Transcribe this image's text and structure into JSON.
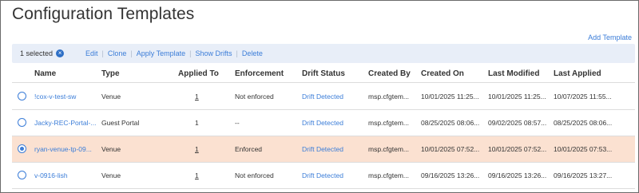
{
  "page": {
    "title": "Configuration Templates",
    "add_template": "Add Template"
  },
  "toolbar": {
    "selected_count": "1 selected",
    "clear_icon": "×",
    "actions": [
      "Edit",
      "Clone",
      "Apply Template",
      "Show Drifts",
      "Delete"
    ]
  },
  "table": {
    "headers": [
      "Name",
      "Type",
      "Applied To",
      "Enforcement",
      "Drift Status",
      "Created By",
      "Created On",
      "Last Modified",
      "Last Applied"
    ],
    "rows": [
      {
        "name": "!cox-v-test-sw",
        "type": "Venue",
        "applied_to": "1",
        "enforcement": "Not enforced",
        "drift_status": "Drift Detected",
        "created_by": "msp.cfgtem...",
        "created_on": "10/01/2025 11:25...",
        "last_modified": "10/01/2025 11:25...",
        "last_applied": "10/07/2025 11:55...",
        "selected": false
      },
      {
        "name": "Jacky-REC-Portal-...",
        "type": "Guest Portal",
        "applied_to": "1",
        "enforcement": "--",
        "drift_status": "Drift Detected",
        "created_by": "msp.cfgtem...",
        "created_on": "08/25/2025 08:06...",
        "last_modified": "09/02/2025 08:57...",
        "last_applied": "08/25/2025 08:06...",
        "selected": false
      },
      {
        "name": "ryan-venue-tp-09...",
        "type": "Venue",
        "applied_to": "1",
        "enforcement": "Enforced",
        "drift_status": "Drift Detected",
        "created_by": "msp.cfgtem...",
        "created_on": "10/01/2025 07:52...",
        "last_modified": "10/01/2025 07:52...",
        "last_applied": "10/01/2025 07:53...",
        "selected": true
      },
      {
        "name": "v-0916-lish",
        "type": "Venue",
        "applied_to": "1",
        "enforcement": "Not enforced",
        "drift_status": "Drift Detected",
        "created_by": "msp.cfgtem...",
        "created_on": "09/16/2025 13:26...",
        "last_modified": "09/16/2025 13:26...",
        "last_applied": "09/16/2025 13:27...",
        "selected": false
      }
    ]
  },
  "colors": {
    "accent": "#3b7dd8",
    "selected_row": "#fbe1d1",
    "toolbar_bg": "#e8eef8"
  }
}
